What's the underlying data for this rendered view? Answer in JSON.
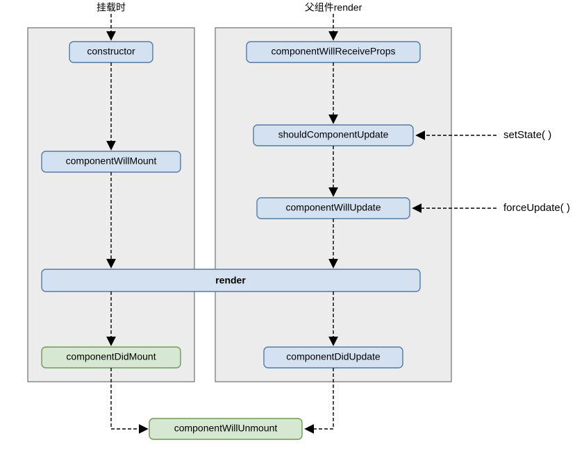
{
  "headers": {
    "mount": "挂载时",
    "update": "父组件render"
  },
  "boxes": {
    "constructor": "constructor",
    "willMount": "componentWillMount",
    "receiveProps": "componentWillReceiveProps",
    "shouldUpdate": "shouldComponentUpdate",
    "willUpdate": "componentWillUpdate",
    "render": "render",
    "didMount": "componentDidMount",
    "didUpdate": "componentDidUpdate",
    "willUnmount": "componentWillUnmount"
  },
  "external": {
    "setState": "setState( )",
    "forceUpdate": "forceUpdate( )"
  }
}
